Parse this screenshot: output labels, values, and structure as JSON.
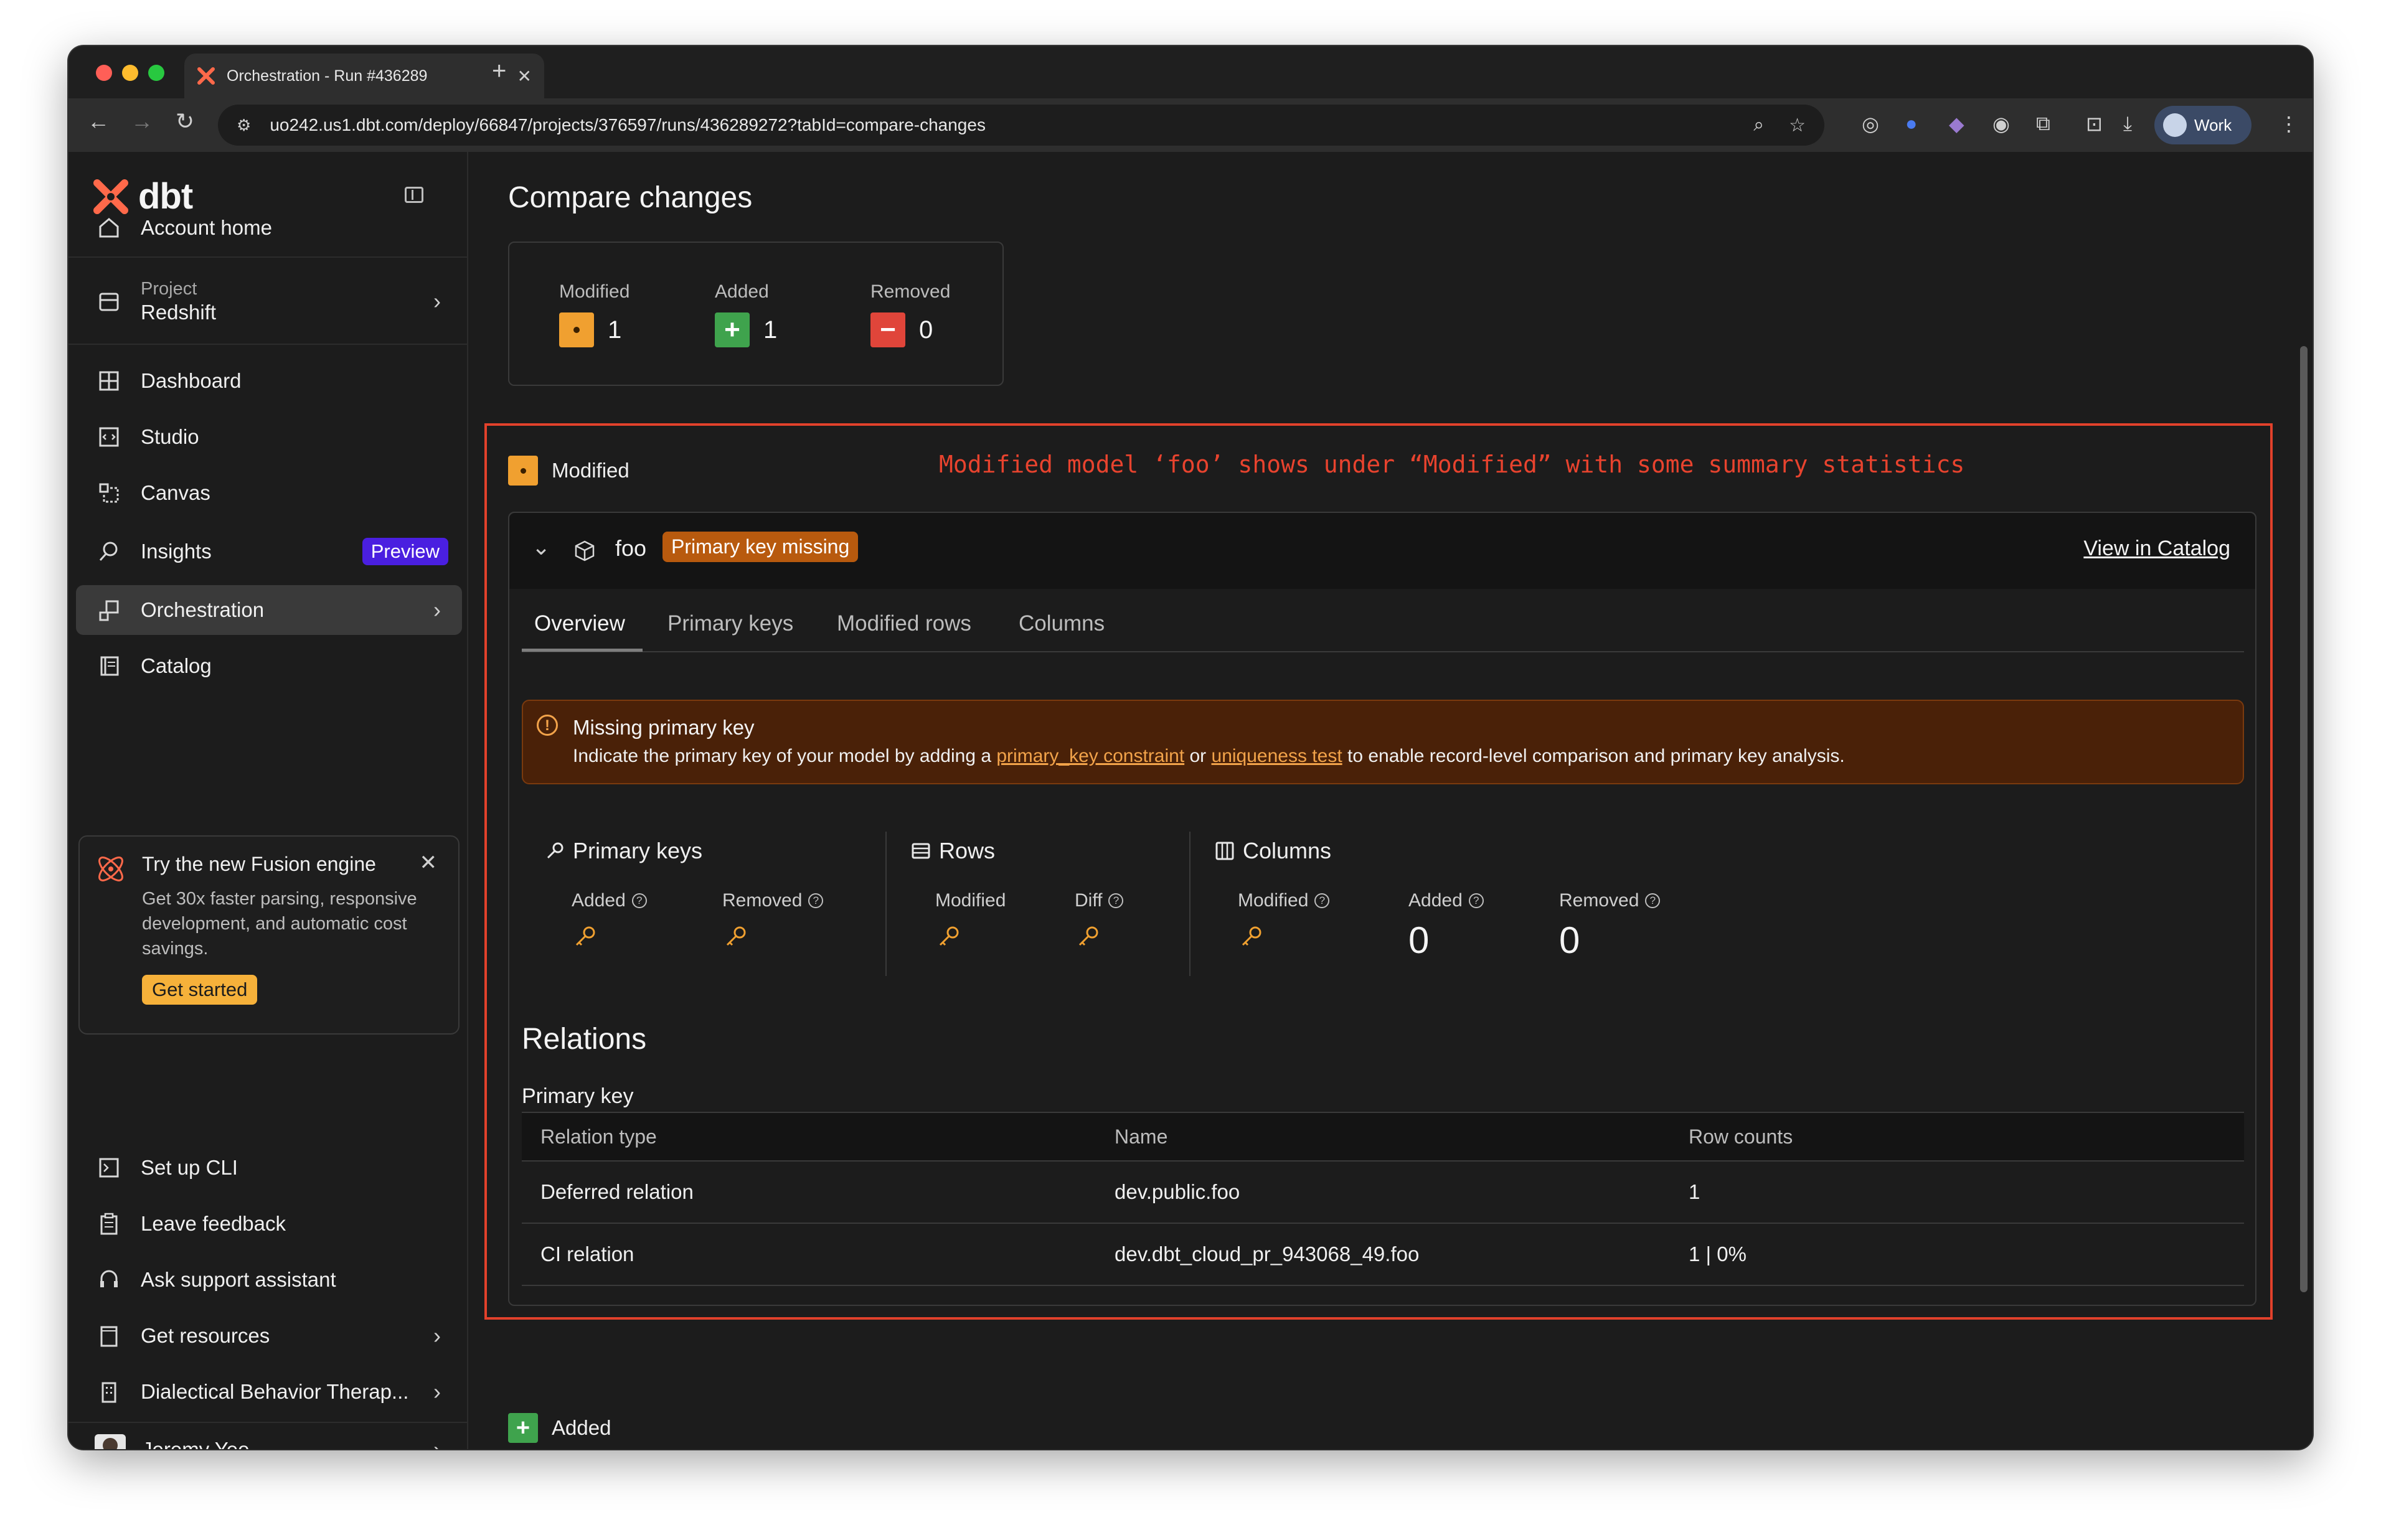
{
  "browser": {
    "tab_title": "Orchestration - Run #436289",
    "url": "uo242.us1.dbt.com/deploy/66847/projects/376597/runs/436289272?tabId=compare-changes",
    "profile_name": "Work"
  },
  "sidebar": {
    "logo_text": "dbt",
    "account_home": "Account home",
    "project_label": "Project",
    "project_name": "Redshift",
    "items": [
      {
        "label": "Dashboard"
      },
      {
        "label": "Studio"
      },
      {
        "label": "Canvas"
      },
      {
        "label": "Insights",
        "badge": "Preview"
      },
      {
        "label": "Orchestration"
      },
      {
        "label": "Catalog"
      }
    ],
    "promo": {
      "title": "Try the new Fusion engine",
      "body": "Get 30x faster parsing, responsive development, and automatic cost savings.",
      "button": "Get started"
    },
    "bottom_items": [
      {
        "label": "Set up CLI"
      },
      {
        "label": "Leave feedback"
      },
      {
        "label": "Ask support assistant"
      },
      {
        "label": "Get resources"
      },
      {
        "label": "Dialectical Behavior Therap..."
      }
    ],
    "user_name": "Jeremy Yeo"
  },
  "main": {
    "title": "Compare changes",
    "summary": {
      "modified_label": "Modified",
      "modified_count": "1",
      "added_label": "Added",
      "added_count": "1",
      "removed_label": "Removed",
      "removed_count": "0"
    },
    "annotation": "Modified model ‘foo’ shows under “Modified” with some summary statistics",
    "modified_section_label": "Modified",
    "model": {
      "name": "foo",
      "badge": "Primary key missing",
      "view_catalog": "View in Catalog"
    },
    "tabs": [
      "Overview",
      "Primary keys",
      "Modified rows",
      "Columns"
    ],
    "alert": {
      "title": "Missing primary key",
      "text_1": "Indicate the primary key of your model by adding a ",
      "link_1": "primary_key constraint",
      "text_2": " or ",
      "link_2": "uniqueness test",
      "text_3": " to enable record-level comparison and primary key analysis."
    },
    "stats": {
      "primary_keys": {
        "title": "Primary keys",
        "added": "Added",
        "removed": "Removed"
      },
      "rows": {
        "title": "Rows",
        "modified": "Modified",
        "diff": "Diff"
      },
      "columns": {
        "title": "Columns",
        "modified": "Modified",
        "added": "Added",
        "added_value": "0",
        "removed": "Removed",
        "removed_value": "0"
      }
    },
    "relations": {
      "title": "Relations",
      "subtitle": "Primary key",
      "headers": [
        "Relation type",
        "Name",
        "Row counts"
      ],
      "rows": [
        {
          "type": "Deferred relation",
          "name": "dev.public.foo",
          "count": "1"
        },
        {
          "type": "CI relation",
          "name": "dev.dbt_cloud_pr_943068_49.foo",
          "count": "1 | 0%"
        }
      ]
    },
    "added_section_label": "Added"
  },
  "colors": {
    "modified": "#f0a030",
    "added": "#3fa34d",
    "removed": "#e0453a",
    "annotation": "#e8432e",
    "preview_badge": "#4a1fe0",
    "warning_bg": "#4a2108"
  }
}
